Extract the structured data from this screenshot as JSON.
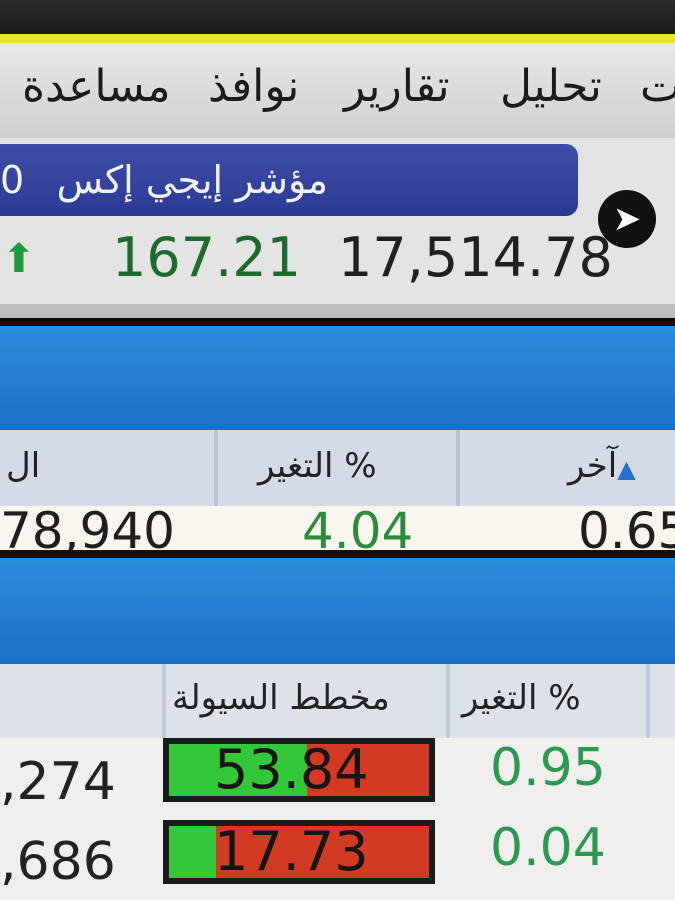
{
  "menu": {
    "items": [
      {
        "label": "مساعدة"
      },
      {
        "label": "نوافذ"
      },
      {
        "label": "تقارير"
      },
      {
        "label": "تحليل"
      },
      {
        "label": "ت"
      }
    ]
  },
  "index": {
    "name": "مؤشر إيجي إكس",
    "name_fragment": "0",
    "value": "17,514.78",
    "change": "167.21",
    "trend_icon": "up-arrow-icon",
    "nav_icon": "navigation-arrow-icon"
  },
  "table1": {
    "headers": {
      "last": "آخر",
      "change_pct": "التغير %",
      "left": "ال"
    },
    "row": {
      "left": "78,940",
      "change_pct": "4.04",
      "last": "0.65"
    }
  },
  "table2": {
    "headers": {
      "liquidity_chart": "مخطط السيولة",
      "change_pct": "التغير %"
    },
    "rows": [
      {
        "left": ",274",
        "liquidity": "53.84",
        "liquidity_fraction": 0.53,
        "change_pct": "0.95"
      },
      {
        "left": ",686",
        "liquidity": "17.73",
        "liquidity_fraction": 0.18,
        "change_pct": "0.04"
      }
    ]
  },
  "colors": {
    "accent_yellow": "#e8e23a",
    "index_bar": "#2b3a94",
    "band_blue": "#1c6fc6",
    "positive_green": "#2c8c3b",
    "liquidity_in": "#33c83a",
    "liquidity_out": "#d23a24"
  }
}
